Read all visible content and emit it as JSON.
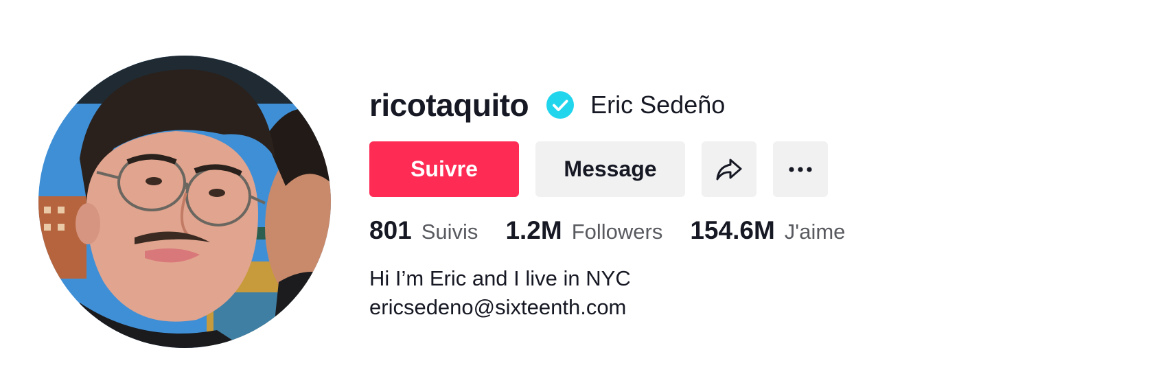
{
  "profile": {
    "username": "ricotaquito",
    "display_name": "Eric Sedeño",
    "verified": true,
    "avatar_alt": "ricotaquito"
  },
  "actions": {
    "follow_label": "Suivre",
    "message_label": "Message",
    "share_icon": "share-icon",
    "more_icon": "more-icon"
  },
  "stats": [
    {
      "value": "801",
      "label": "Suivis"
    },
    {
      "value": "1.2M",
      "label": "Followers"
    },
    {
      "value": "154.6M",
      "label": "J'aime"
    }
  ],
  "bio": {
    "line1": "Hi I’m Eric and I live in NYC",
    "line2": "ericsedeno@sixteenth.com"
  },
  "colors": {
    "follow_button": "#fe2c55",
    "secondary_button": "#f1f1f2",
    "verified_badge": "#20d5ec",
    "text_primary": "#161823",
    "text_secondary": "#585a5f"
  }
}
